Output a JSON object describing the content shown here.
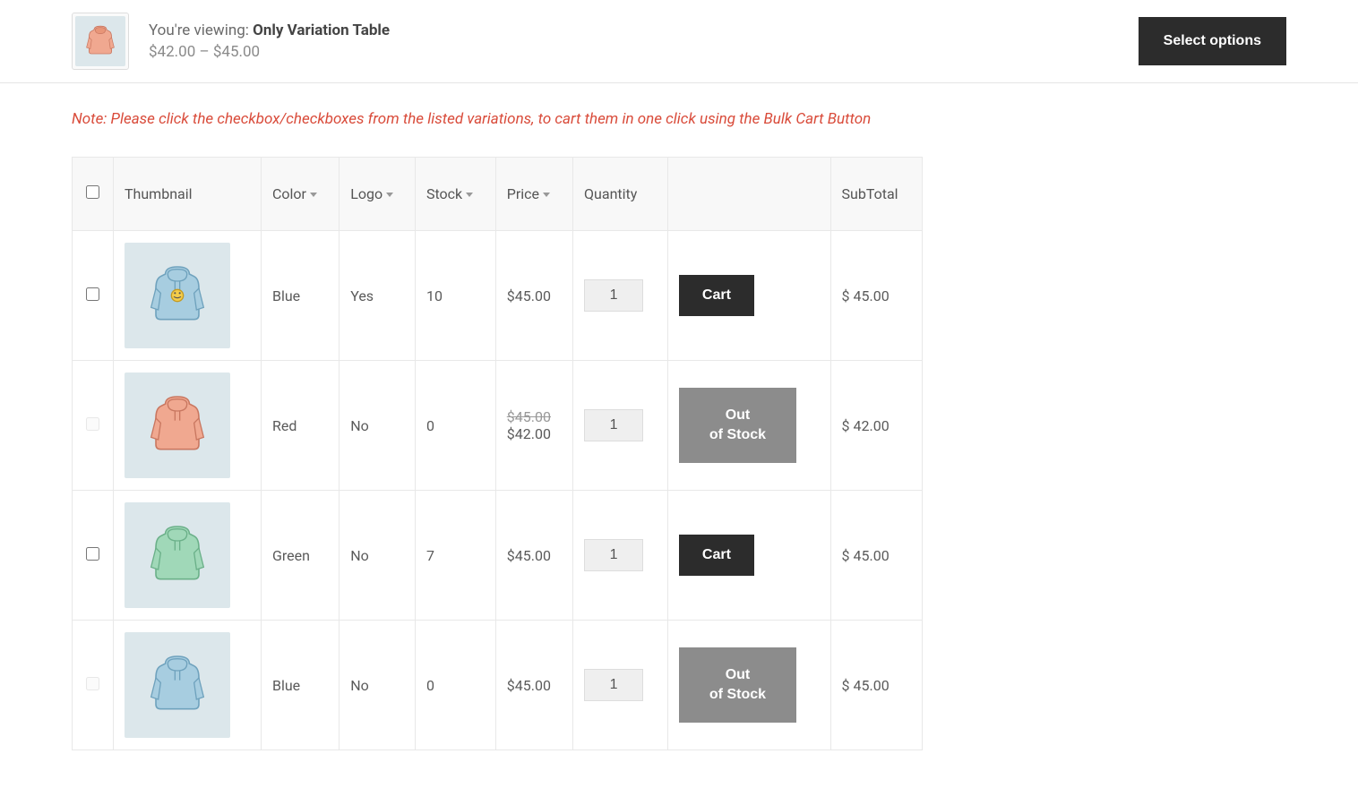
{
  "header": {
    "viewing_prefix": "You're viewing: ",
    "product_name": "Only Variation Table",
    "price_range": "$42.00 – $45.00",
    "select_options_label": "Select options"
  },
  "note": "Note: Please click the checkbox/checkboxes from the listed variations, to cart them in one click using the Bulk Cart Button",
  "table": {
    "headers": {
      "thumbnail": "Thumbnail",
      "color": "Color",
      "logo": "Logo",
      "stock": "Stock",
      "price": "Price",
      "quantity": "Quantity",
      "action": "",
      "subtotal": "SubTotal"
    },
    "rows": [
      {
        "color": "Blue",
        "logo": "Yes",
        "stock": "10",
        "price": "$45.00",
        "original_price": "",
        "quantity": "1",
        "action_label": "Cart",
        "in_stock": true,
        "subtotal": "$ 45.00",
        "hoodie_color": "blue",
        "has_logo": true
      },
      {
        "color": "Red",
        "logo": "No",
        "stock": "0",
        "price": "$42.00",
        "original_price": "$45.00",
        "quantity": "1",
        "action_label": "Out of Stock",
        "in_stock": false,
        "subtotal": "$ 42.00",
        "hoodie_color": "red",
        "has_logo": false
      },
      {
        "color": "Green",
        "logo": "No",
        "stock": "7",
        "price": "$45.00",
        "original_price": "",
        "quantity": "1",
        "action_label": "Cart",
        "in_stock": true,
        "subtotal": "$ 45.00",
        "hoodie_color": "green",
        "has_logo": false
      },
      {
        "color": "Blue",
        "logo": "No",
        "stock": "0",
        "price": "$45.00",
        "original_price": "",
        "quantity": "1",
        "action_label": "Out of Stock",
        "in_stock": false,
        "subtotal": "$ 45.00",
        "hoodie_color": "blue",
        "has_logo": false
      }
    ]
  }
}
